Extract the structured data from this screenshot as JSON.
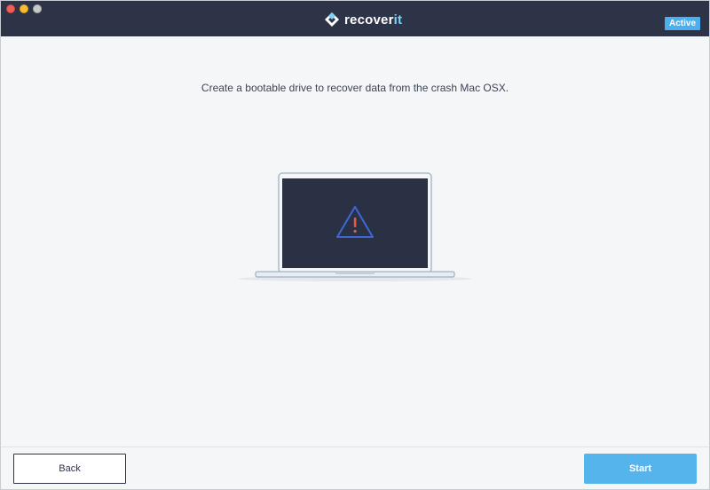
{
  "window": {
    "traffic_lights": [
      "close",
      "minimize",
      "zoom"
    ]
  },
  "header": {
    "brand_main": "recover",
    "brand_accent": "it",
    "badge": "Active",
    "colors": {
      "bar": "#2e3447",
      "badge": "#4ab0f0"
    }
  },
  "main": {
    "message": "Create a bootable drive to recover data from the crash Mac OSX.",
    "illustration_icon": "laptop-warning-icon"
  },
  "footer": {
    "back_label": "Back",
    "start_label": "Start",
    "colors": {
      "start": "#56b4ed"
    }
  }
}
